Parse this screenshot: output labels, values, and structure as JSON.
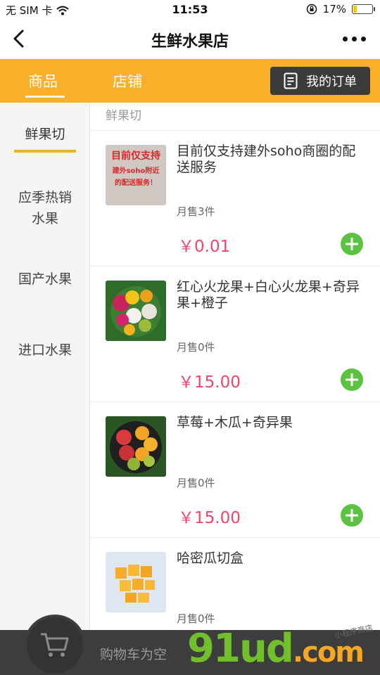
{
  "status_bar": {
    "carrier": "无 SIM 卡",
    "time": "11:53",
    "battery": "17%",
    "battery_level": 0.17
  },
  "nav": {
    "title": "生鲜水果店"
  },
  "tabs": {
    "goods": "商品",
    "shop": "店铺",
    "orders": "我的订单"
  },
  "categories": [
    {
      "label": "鲜果切",
      "active": true
    },
    {
      "label": "应季热销\n水果"
    },
    {
      "label": "国产水果"
    },
    {
      "label": "进口水果"
    }
  ],
  "section_title": "鲜果切",
  "products": [
    {
      "name": "目前仅支持建外soho商圈的配送服务",
      "sales": "月售3件",
      "price": "￥0.01",
      "thumb_text_1": "目前仅支持",
      "thumb_text_2": "建外soho附近",
      "thumb_text_3": "的配送服务！"
    },
    {
      "name": "红心火龙果+白心火龙果+奇异果+橙子",
      "sales": "月售0件",
      "price": "￥15.00"
    },
    {
      "name": "草莓+木瓜+奇异果",
      "sales": "月售0件",
      "price": "￥15.00"
    },
    {
      "name": "哈密瓜切盒",
      "sales": "月售0件",
      "price": ""
    }
  ],
  "cart": {
    "empty_text": "购物车为空"
  },
  "watermark": {
    "brand": "91ud",
    "suffix": ".com",
    "tagline": "小程序商店"
  }
}
